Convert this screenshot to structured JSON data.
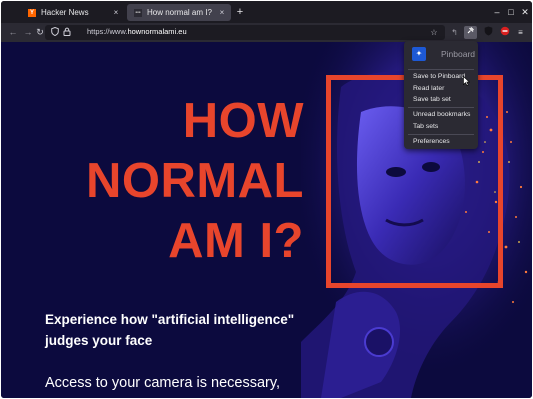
{
  "tabs": [
    {
      "title": "Hacker News",
      "favicon": "hn-favicon",
      "active": false
    },
    {
      "title": "How normal am I?",
      "favicon": "hownormalami-favicon",
      "active": true
    }
  ],
  "tab_close_glyph": "×",
  "new_tab_glyph": "+",
  "window_controls": {
    "minimize": "–",
    "maximize": "□",
    "close": "✕"
  },
  "address_bar": {
    "scheme": "https://www.",
    "host": "hownormalami.eu"
  },
  "page": {
    "title_lines": [
      "HOW",
      "NORMAL",
      "AM I?"
    ],
    "subtitle": "Experience how \"artificial intelligence\" judges your face",
    "body_text": "Access to your camera is necessary,"
  },
  "pinboard_popup": {
    "title": "Pinboard",
    "items": [
      "Save to Pinboard",
      "Read later",
      "Save tab set",
      "Unread bookmarks",
      "Tab sets",
      "Preferences"
    ]
  },
  "colors": {
    "accent_red": "#e8452c",
    "page_background": "#0c0a3e",
    "browser_chrome": "#1c1b22",
    "toolbar": "#2b2a33",
    "pinboard_blue": "#1d59d6"
  },
  "icons": [
    "back-icon",
    "forward-icon",
    "reload-icon",
    "shield-icon",
    "lock-icon",
    "bookmark-star-icon",
    "reader-icon",
    "pinboard-extension-icon",
    "ublock-icon",
    "adblock-icon",
    "menu-icon"
  ]
}
